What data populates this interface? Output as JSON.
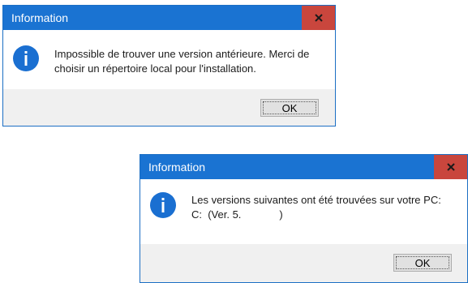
{
  "dialog1": {
    "title": "Information",
    "close_glyph": "x",
    "icon": "info-icon",
    "message_line1": "Impossible de trouver une version antérieure. Merci de",
    "message_line2": "choisir un répertoire local pour l'installation.",
    "ok_label": "OK"
  },
  "dialog2": {
    "title": "Information",
    "close_glyph": "x",
    "icon": "info-icon",
    "message_line1": "Les versions suivantes ont été trouvées sur votre PC:",
    "message_line2": "C:  (Ver. 5.             )",
    "ok_label": "OK"
  },
  "colors": {
    "titlebar": "#1a73d2",
    "close_button": "#c9463d",
    "info_icon": "#1a6fd1",
    "footer": "#f0f0f0"
  }
}
